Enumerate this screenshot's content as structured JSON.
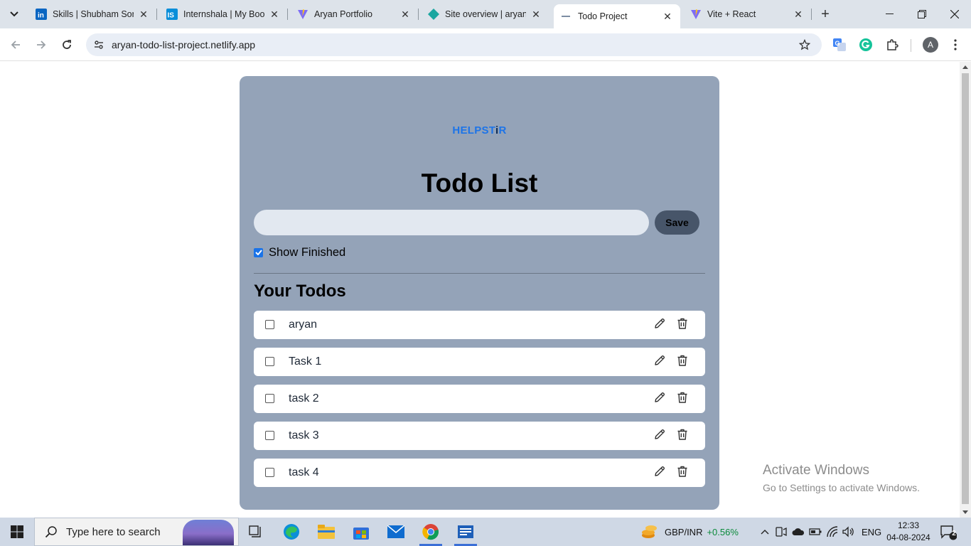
{
  "browser": {
    "tabs": [
      {
        "title": "Skills | Shubham Soni",
        "favicon": "linkedin-icon",
        "active": false
      },
      {
        "title": "Internshala | My Book",
        "favicon": "internshala-icon",
        "active": false
      },
      {
        "title": "Aryan Portfolio",
        "favicon": "vite-icon",
        "active": false
      },
      {
        "title": "Site overview | aryan-",
        "favicon": "netlify-icon",
        "active": false
      },
      {
        "title": "Todo Project",
        "favicon": "loading-dash-icon",
        "active": true
      },
      {
        "title": "Vite + React",
        "favicon": "vite-icon",
        "active": false
      }
    ],
    "url": "aryan-todo-list-project.netlify.app",
    "profile_initial": "A"
  },
  "app": {
    "brand_prefix": "HELPST",
    "brand_mid": "i",
    "brand_suffix": "R",
    "title": "Todo List",
    "input_value": "",
    "save_label": "Save",
    "show_finished_label": "Show Finished",
    "show_finished_checked": true,
    "todos_heading": "Your Todos",
    "todos": [
      {
        "text": "aryan",
        "done": false
      },
      {
        "text": "Task 1",
        "done": false
      },
      {
        "text": "task 2",
        "done": false
      },
      {
        "text": "task 3",
        "done": false
      },
      {
        "text": "task 4",
        "done": false
      }
    ]
  },
  "watermark": {
    "line1": "Activate Windows",
    "line2": "Go to Settings to activate Windows."
  },
  "taskbar": {
    "search_placeholder": "Type here to search",
    "ticker_name": "GBP/INR",
    "ticker_change": "+0.56%",
    "language": "ENG",
    "time": "12:33",
    "date": "04-08-2024",
    "notification_count": "2"
  },
  "colors": {
    "card_bg": "#94a3b8",
    "save_btn": "#475569",
    "input_bg": "#e2e8f0",
    "brand_blue": "#1d74e8",
    "ticker_green": "#0a8a3a"
  }
}
